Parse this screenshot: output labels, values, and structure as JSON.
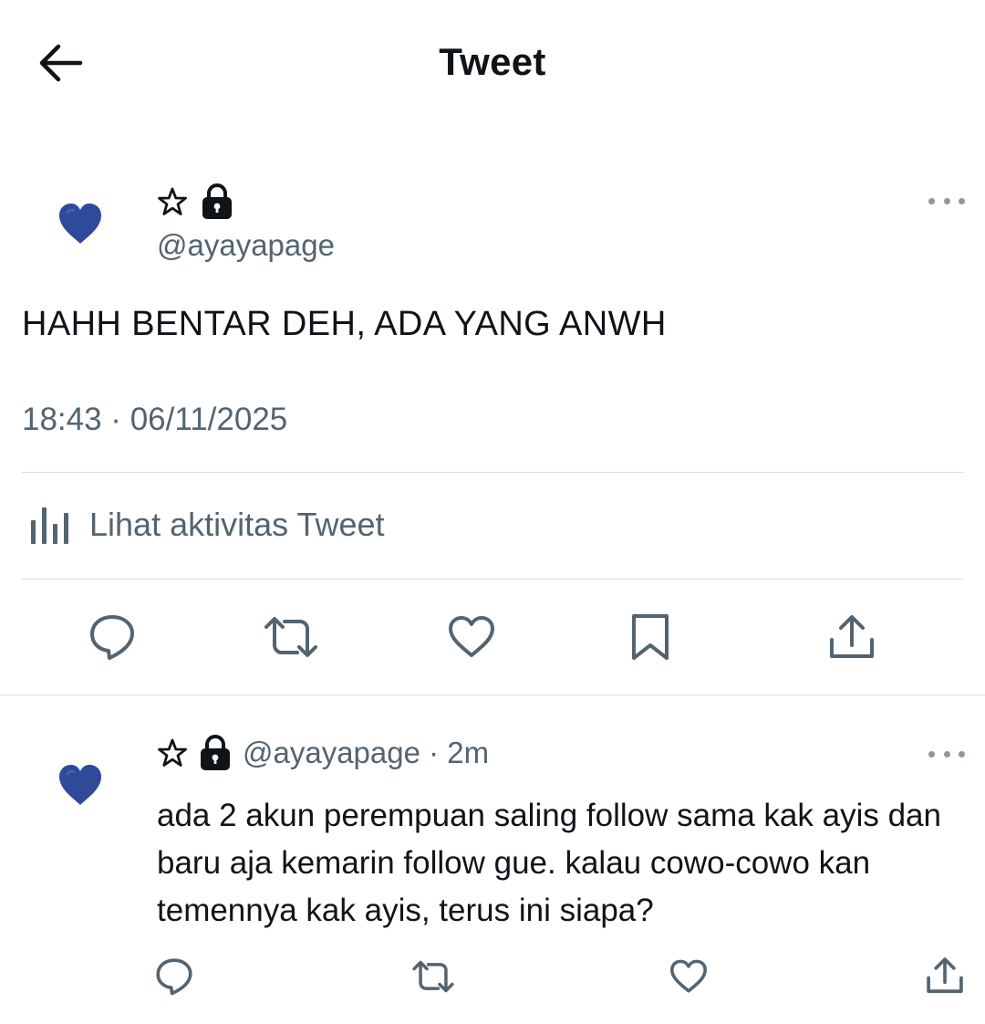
{
  "header": {
    "title": "Tweet",
    "back_icon": "arrow-left-icon"
  },
  "main_tweet": {
    "avatar_icon": "blue-heart-icon",
    "name_symbols": [
      "star-outline-icon",
      "lock-icon"
    ],
    "handle": "@ayayapage",
    "text": "HAHH BENTAR DEH, ADA YANG ANWH",
    "timestamp": "18:43 · 06/11/2025",
    "activity_label": "Lihat aktivitas Tweet",
    "actions": [
      "reply-icon",
      "retweet-icon",
      "like-icon",
      "bookmark-icon",
      "share-icon"
    ]
  },
  "reply": {
    "avatar_icon": "blue-heart-icon",
    "name_symbols": [
      "star-outline-icon",
      "lock-icon"
    ],
    "handle": "@ayayapage",
    "time": "2m",
    "handle_time": "@ayayapage · 2m",
    "text": "ada 2 akun perempuan saling follow sama kak ayis dan baru aja kemarin follow gue. kalau cowo-cowo kan temennya kak ayis, terus ini siapa?",
    "actions": [
      "reply-icon",
      "retweet-icon",
      "like-icon",
      "share-icon"
    ]
  },
  "colors": {
    "text": "#0f1419",
    "secondary": "#536471",
    "divider": "#d9dee2",
    "heart": "#2e4a99"
  }
}
